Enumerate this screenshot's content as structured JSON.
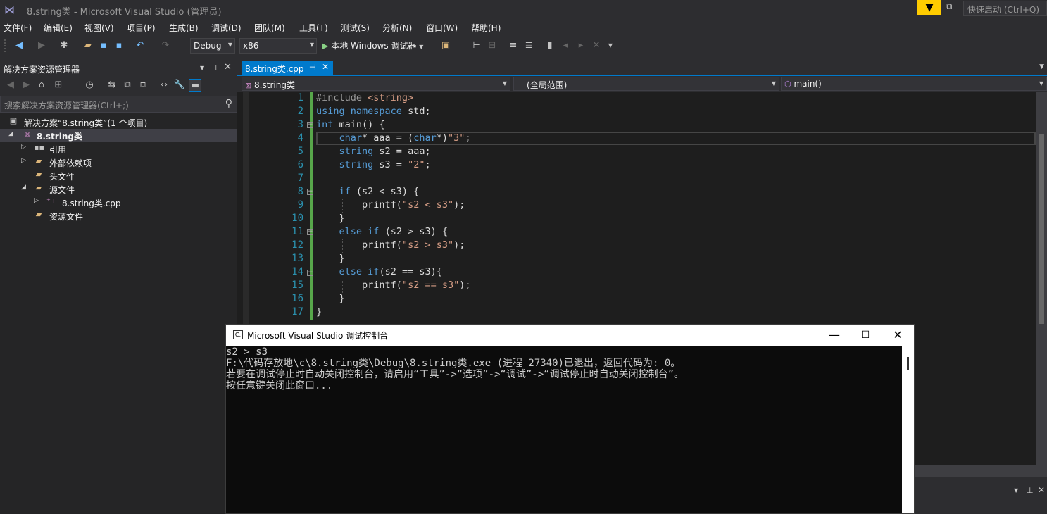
{
  "window": {
    "title": "8.string类 - Microsoft Visual Studio (管理员)",
    "quick_launch_placeholder": "快速启动 (Ctrl+Q)"
  },
  "menu": [
    "文件(F)",
    "编辑(E)",
    "视图(V)",
    "项目(P)",
    "生成(B)",
    "调试(D)",
    "团队(M)",
    "工具(T)",
    "测试(S)",
    "分析(N)",
    "窗口(W)",
    "帮助(H)"
  ],
  "toolbar": {
    "configuration": "Debug",
    "platform": "x86",
    "run_label": "本地 Windows 调试器"
  },
  "solution_explorer": {
    "title": "解决方案资源管理器",
    "search_placeholder": "搜索解决方案资源管理器(Ctrl+;)",
    "solution_label": "解决方案“8.string类”(1 个项目)",
    "project_label": "8.string类",
    "items": [
      "引用",
      "外部依赖项",
      "头文件",
      "源文件",
      "8.string类.cpp",
      "资源文件"
    ]
  },
  "editor": {
    "tab_label": "8.string类.cpp",
    "nav_project": "8.string类",
    "nav_scope": "(全局范围)",
    "nav_function": "main()",
    "line_numbers": [
      "1",
      "2",
      "3",
      "4",
      "5",
      "6",
      "7",
      "8",
      "9",
      "10",
      "11",
      "12",
      "13",
      "14",
      "15",
      "16",
      "17"
    ],
    "code": {
      "l1_a": "#include ",
      "l1_b": "<string>",
      "l2_a": "using",
      "l2_b": "namespace",
      "l2_c": " std;",
      "l3_a": "int",
      "l3_b": " main() {",
      "l4_a": "char",
      "l4_b": "* aaa = (",
      "l4_c": "char",
      "l4_d": "*)",
      "l4_e": "\"3\"",
      "l4_f": ";",
      "l5_a": "string",
      "l5_b": " s2 = aaa;",
      "l6_a": "string",
      "l6_b": " s3 = ",
      "l6_c": "\"2\"",
      "l6_d": ";",
      "l8_a": "if",
      "l8_b": " (s2 < s3) {",
      "l9_a": "printf(",
      "l9_b": "\"s2 < s3\"",
      "l9_c": ");",
      "l10": "}",
      "l11_a": "else",
      "l11_b": "if",
      "l11_c": " (s2 > s3) {",
      "l12_a": "printf(",
      "l12_b": "\"s2 > s3\"",
      "l12_c": ");",
      "l13": "}",
      "l14_a": "else",
      "l14_b": "if",
      "l14_c": "(s2 == s3){",
      "l15_a": "printf(",
      "l15_b": "\"s2 == s3\"",
      "l15_c": ");",
      "l16": "}",
      "l17": "}"
    }
  },
  "console": {
    "title": "Microsoft Visual Studio 调试控制台",
    "lines": [
      "s2 > s3",
      "F:\\代码存放地\\c\\8.string类\\Debug\\8.string类.exe (进程 27340)已退出，返回代码为: 0。",
      "若要在调试停止时自动关闭控制台，请启用“工具”->“选项”->“调试”->“调试停止时自动关闭控制台”。",
      "按任意键关闭此窗口..."
    ]
  },
  "colors": {
    "accent": "#007acc",
    "keyword": "#569cd6",
    "string": "#d69d85",
    "line_number": "#2b91af",
    "filter_badge": "#ffcc00"
  }
}
